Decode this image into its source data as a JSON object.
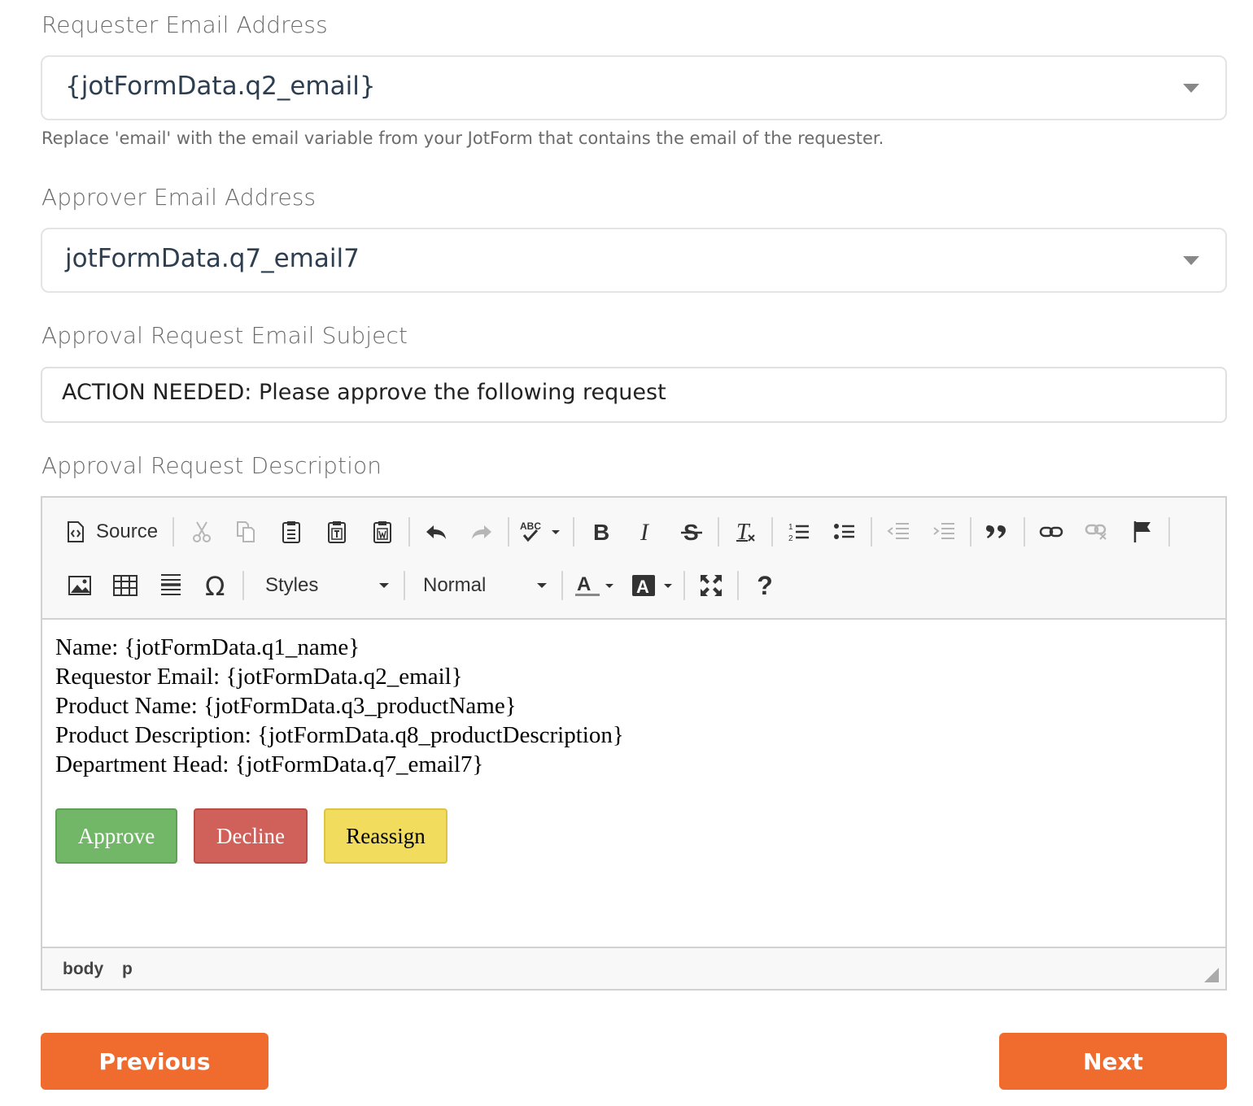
{
  "requester": {
    "label": "Requester Email Address",
    "value": "{jotFormData.q2_email}",
    "hint": "Replace 'email' with the email variable from your JotForm that contains the email of the requester."
  },
  "approver": {
    "label": "Approver Email Address",
    "value": "jotFormData.q7_email7"
  },
  "subject": {
    "label": "Approval Request Email Subject",
    "value": "ACTION NEEDED: Please approve the following request"
  },
  "description": {
    "label": "Approval Request Description",
    "toolbar": {
      "source_label": "Source",
      "styles_label": "Styles",
      "format_label": "Normal",
      "help_label": "?"
    },
    "body_lines": [
      "Name: {jotFormData.q1_name}",
      "Requestor Email: {jotFormData.q2_email}",
      "Product Name: {jotFormData.q3_productName}",
      "Product Description: {jotFormData.q8_productDescription}",
      "Department Head: {jotFormData.q7_email7}"
    ],
    "buttons": {
      "approve": "Approve",
      "decline": "Decline",
      "reassign": "Reassign"
    },
    "path": [
      "body",
      "p"
    ]
  },
  "nav": {
    "previous": "Previous",
    "next": "Next"
  },
  "colors": {
    "accent": "#ef6c2e",
    "approve": "#72b768",
    "decline": "#d0615a",
    "reassign": "#f1dc5e"
  }
}
